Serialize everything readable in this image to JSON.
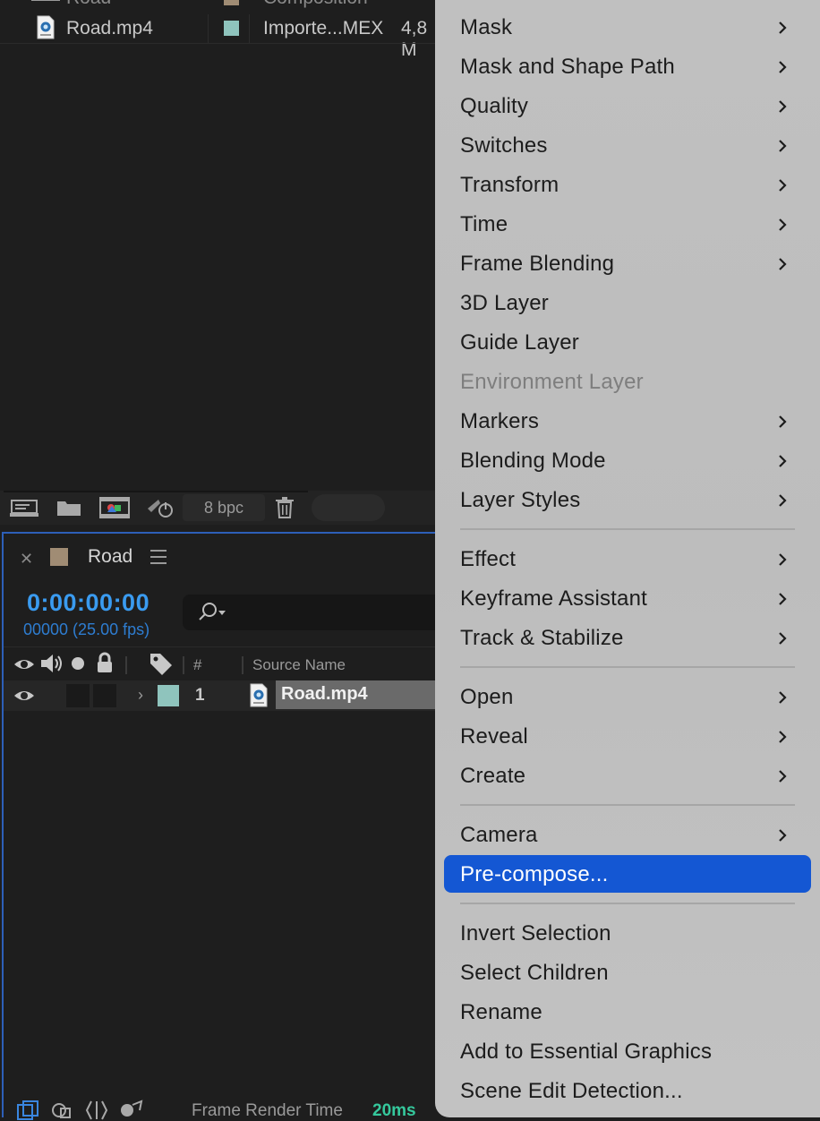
{
  "project": {
    "partial_row": {
      "name": "Road",
      "type": "Composition"
    },
    "file_row": {
      "name": "Road.mp4",
      "type": "Importe...MEX",
      "size": "4,8 M",
      "swatch_color": "#8fc4bd"
    },
    "footer": {
      "bpc": "8 bpc"
    }
  },
  "timeline": {
    "tab_title": "Road",
    "tab_swatch_color": "#a08c74",
    "timecode": "0:00:00:00",
    "frames_fps": "00000 (25.00 fps)",
    "columns": {
      "number": "#",
      "source_name": "Source Name"
    },
    "layer": {
      "number": "1",
      "name": "Road.mp4",
      "label_color": "#8fc4bd"
    },
    "footer": {
      "render_label": "Frame Render Time",
      "render_value": "20ms"
    }
  },
  "menu": {
    "items": [
      {
        "label": "Mask",
        "submenu": true
      },
      {
        "label": "Mask and Shape Path",
        "submenu": true
      },
      {
        "label": "Quality",
        "submenu": true
      },
      {
        "label": "Switches",
        "submenu": true
      },
      {
        "label": "Transform",
        "submenu": true
      },
      {
        "label": "Time",
        "submenu": true
      },
      {
        "label": "Frame Blending",
        "submenu": true
      },
      {
        "label": "3D Layer",
        "submenu": false
      },
      {
        "label": "Guide Layer",
        "submenu": false
      },
      {
        "label": "Environment Layer",
        "submenu": false,
        "disabled": true
      },
      {
        "label": "Markers",
        "submenu": true
      },
      {
        "label": "Blending Mode",
        "submenu": true
      },
      {
        "label": "Layer Styles",
        "submenu": true
      },
      {
        "label": "Effect",
        "submenu": true
      },
      {
        "label": "Keyframe Assistant",
        "submenu": true
      },
      {
        "label": "Track & Stabilize",
        "submenu": true
      },
      {
        "label": "Open",
        "submenu": true
      },
      {
        "label": "Reveal",
        "submenu": true
      },
      {
        "label": "Create",
        "submenu": true
      },
      {
        "label": "Camera",
        "submenu": true
      },
      {
        "label": "Pre-compose...",
        "submenu": false,
        "selected": true
      },
      {
        "label": "Invert Selection",
        "submenu": false
      },
      {
        "label": "Select Children",
        "submenu": false
      },
      {
        "label": "Rename",
        "submenu": false
      },
      {
        "label": "Add to Essential Graphics",
        "submenu": false
      },
      {
        "label": "Scene Edit Detection...",
        "submenu": false
      }
    ],
    "selection_color": "#1457d3"
  }
}
